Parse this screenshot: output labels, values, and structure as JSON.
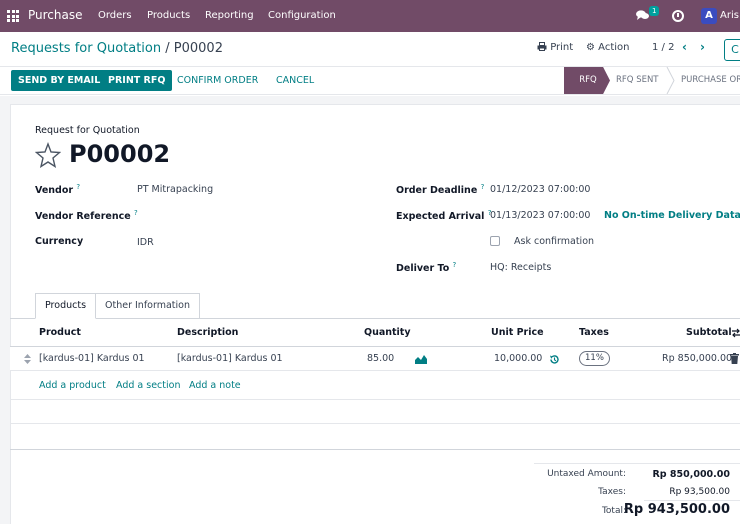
{
  "navbar": {
    "app_name": "Purchase",
    "menu": [
      "Orders",
      "Products",
      "Reporting",
      "Configuration"
    ],
    "chat_badge": "1",
    "avatar_initial": "A",
    "user_name": "Aris"
  },
  "control": {
    "breadcrumb_parent": "Requests for Quotation",
    "breadcrumb_sep": "/",
    "breadcrumb_current": "P00002",
    "print_label": "Print",
    "action_label": "Action",
    "pager": "1 / 2",
    "new_label": "C"
  },
  "statusbar": {
    "send_email": "SEND BY EMAIL",
    "print_rfq": "PRINT RFQ",
    "confirm_order": "CONFIRM ORDER",
    "cancel": "CANCEL",
    "stages": [
      "RFQ",
      "RFQ SENT",
      "PURCHASE OR"
    ]
  },
  "form": {
    "type_label": "Request for Quotation",
    "name": "P00002",
    "vendor_label": "Vendor",
    "vendor": "PT Mitrapacking",
    "vendor_ref_label": "Vendor Reference",
    "currency_label": "Currency",
    "currency": "IDR",
    "order_deadline_label": "Order Deadline",
    "order_deadline": "01/12/2023 07:00:00",
    "expected_arrival_label": "Expected Arrival",
    "expected_arrival": "01/13/2023 07:00:00",
    "on_time_label": "No On-time Delivery Data",
    "ask_confirmation_label": "Ask confirmation",
    "deliver_to_label": "Deliver To",
    "deliver_to": "HQ: Receipts",
    "help_mark": "?"
  },
  "tabs": [
    "Products",
    "Other Information"
  ],
  "table": {
    "headers": [
      "Product",
      "Description",
      "Quantity",
      "Unit Price",
      "Taxes",
      "Subtotal"
    ],
    "rows": [
      {
        "product": "[kardus-01] Kardus 01",
        "description": "[kardus-01] Kardus 01",
        "quantity": "85.00",
        "unit_price": "10,000.00",
        "taxes": "11%",
        "subtotal": "Rp 850,000.00"
      }
    ],
    "add_product": "Add a product",
    "add_section": "Add a section",
    "add_note": "Add a note"
  },
  "totals": {
    "untaxed_label": "Untaxed Amount:",
    "untaxed": "Rp 850,000.00",
    "taxes_label": "Taxes:",
    "taxes": "Rp 93,500.00",
    "total_label": "Total:",
    "total": "Rp 943,500.00"
  },
  "colors": {
    "navbar": "#714B67",
    "accent": "#017E84",
    "avatar": "#3B4CC0"
  }
}
